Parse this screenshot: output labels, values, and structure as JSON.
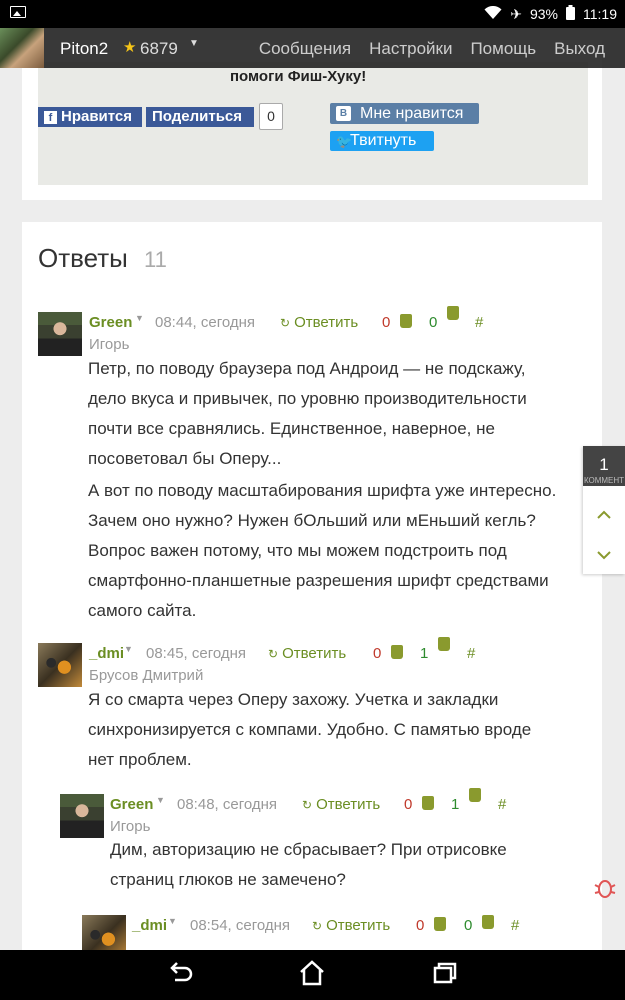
{
  "status_bar": {
    "battery": "93%",
    "time": "11:19"
  },
  "nav": {
    "username": "Piton2",
    "score": "6879",
    "menu": [
      "Сообщения",
      "Настройки",
      "Помощь",
      "Выход"
    ]
  },
  "top_card": {
    "title": "помоги Фиш-Хуку!",
    "fb_like": "Нравится",
    "share": "Поделиться",
    "share_count": "0",
    "vk_like": "Мне нравится",
    "tweet": "Твитнуть"
  },
  "answers": {
    "title": "Ответы",
    "count": "11",
    "reply_label": "Ответить",
    "hash": "#",
    "comments": [
      {
        "user": "Green",
        "time": "08:44, сегодня",
        "down": "0",
        "up": "0",
        "full_name": "Игорь",
        "paragraphs": [
          "Петр, по поводу браузера под Андроид — не подскажу, дело вкуса и привычек, по уровню производительности почти все сравнялись. Единственное, наверное, не посоветовал бы Оперу...",
          "А вот по поводу масштабирования шрифта уже интересно. Зачем оно нужно? Нужен бОльший или мЕньший кегль? Вопрос важен потому, что мы можем подстроить под смартфонно-планшетные разрешения шрифт средствами самого сайта."
        ]
      },
      {
        "user": "_dmi",
        "time": "08:45, сегодня",
        "down": "0",
        "up": "1",
        "full_name": "Брусов Дмитрий",
        "paragraphs": [
          "Я со смарта через Оперу захожу. Учетка и закладки синхронизируется с компами. Удобно. С памятью вроде нет проблем."
        ]
      },
      {
        "user": "Green",
        "time": "08:48, сегодня",
        "down": "0",
        "up": "1",
        "full_name": "Игорь",
        "paragraphs": [
          "Дим, авторизацию не сбрасывает? При отрисовке страниц глюков не замечено?"
        ]
      },
      {
        "user": "_dmi",
        "time": "08:54, сегодня",
        "down": "0",
        "up": "0",
        "full_name": "",
        "paragraphs": []
      }
    ]
  },
  "side_widget": {
    "count": "1",
    "caption": "КОММЕНТ"
  }
}
